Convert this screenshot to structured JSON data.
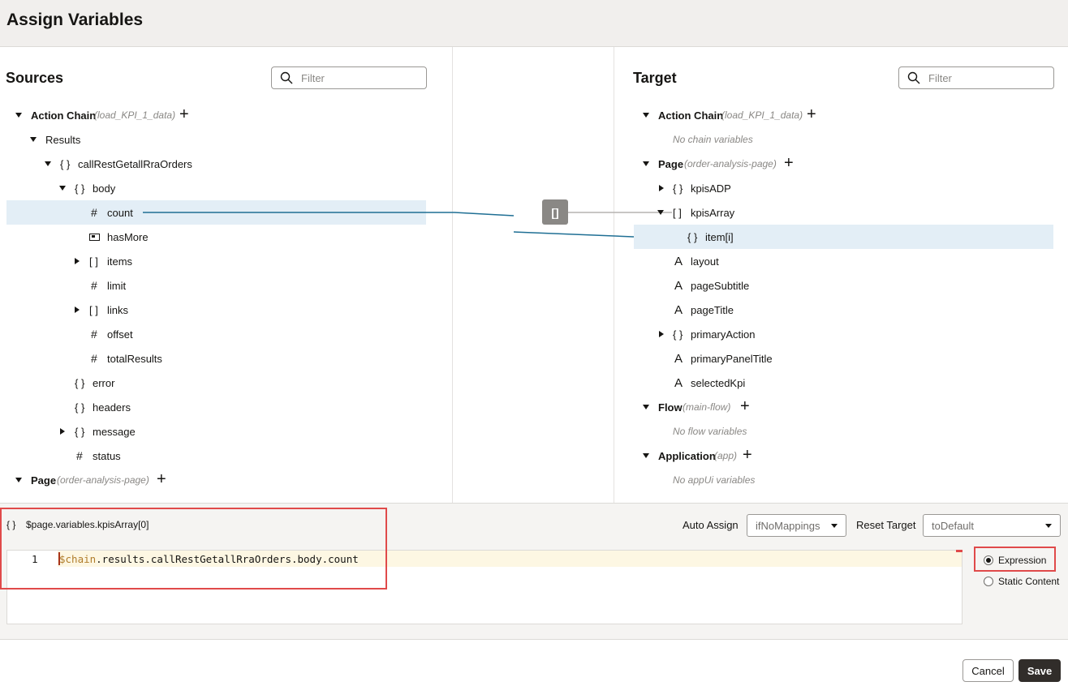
{
  "title": "Assign Variables",
  "sources": {
    "title": "Sources",
    "filter_placeholder": "Filter",
    "action_chain": {
      "label": "Action Chain",
      "sub": "(load_KPI_1_data)"
    },
    "results": "Results",
    "call": "callRestGetallRraOrders",
    "body": "body",
    "items": [
      {
        "icon": "#",
        "label": "count"
      },
      {
        "icon": "▣",
        "label": "hasMore"
      },
      {
        "icon": "[ ]",
        "label": "items"
      },
      {
        "icon": "#",
        "label": "limit"
      },
      {
        "icon": "[ ]",
        "label": "links"
      },
      {
        "icon": "#",
        "label": "offset"
      },
      {
        "icon": "#",
        "label": "totalResults"
      }
    ],
    "error": "error",
    "headers": "headers",
    "message": "message",
    "status": "status",
    "page": {
      "label": "Page",
      "sub": "(order-analysis-page)"
    }
  },
  "target": {
    "title": "Target",
    "filter_placeholder": "Filter",
    "action_chain": {
      "label": "Action Chain",
      "sub": "(load_KPI_1_data)"
    },
    "no_chain": "No chain variables",
    "page": {
      "label": "Page",
      "sub": "(order-analysis-page)"
    },
    "kpisADP": "kpisADP",
    "kpisArray": "kpisArray",
    "item": "item[i]",
    "fields": [
      "layout",
      "pageSubtitle",
      "pageTitle"
    ],
    "primaryAction": "primaryAction",
    "fields2": [
      "primaryPanelTitle",
      "selectedKpi"
    ],
    "flow": {
      "label": "Flow",
      "sub": "(main-flow)"
    },
    "no_flow": "No flow variables",
    "application": {
      "label": "Application",
      "sub": "(app)"
    },
    "no_app": "No appUi variables"
  },
  "mapper_icon": "[]",
  "expression_target": "$page.variables.kpisArray[0]",
  "auto_assign": {
    "label": "Auto Assign",
    "value": "ifNoMappings"
  },
  "reset_target": {
    "label": "Reset Target",
    "value": "toDefault"
  },
  "editor": {
    "line_no": "1",
    "code_prefix": "$chain",
    "code_rest": ".results.callRestGetallRraOrders.body.count"
  },
  "mode": {
    "expression": "Expression",
    "static": "Static Content",
    "selected": "Expression"
  },
  "buttons": {
    "cancel": "Cancel",
    "save": "Save"
  },
  "colors": {
    "accent": "#1f6f94",
    "highlight": "#e3eef6",
    "annotation": "#e04a4a",
    "save_bg": "#312d2a"
  }
}
